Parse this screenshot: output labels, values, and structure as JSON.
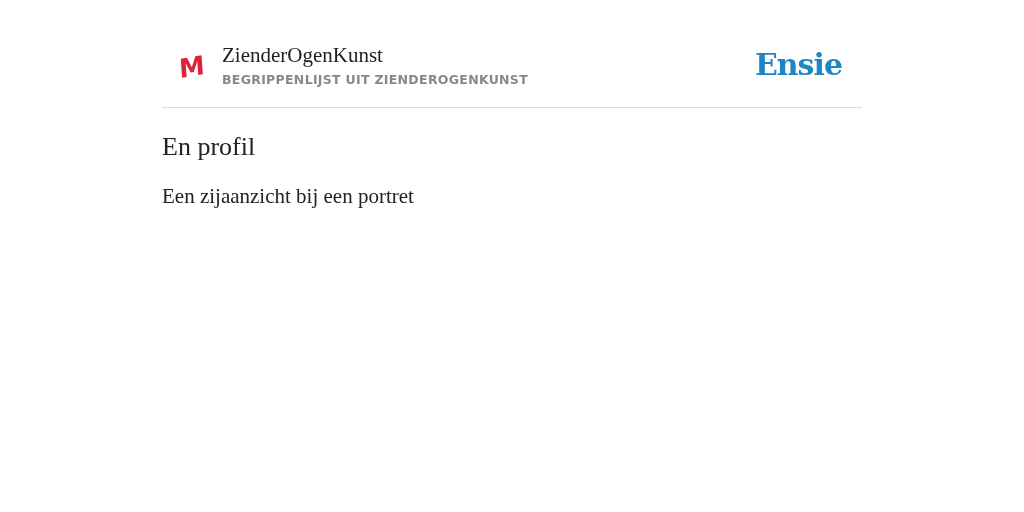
{
  "header": {
    "logo": "M",
    "title": "ZienderOgenKunst",
    "subtitle": "BEGRIPPENLIJST UIT ZIENDEROGENKUNST",
    "brand": "Ensie"
  },
  "term": {
    "title": "En profil",
    "definition": "Een zijaanzicht bij een portret"
  }
}
